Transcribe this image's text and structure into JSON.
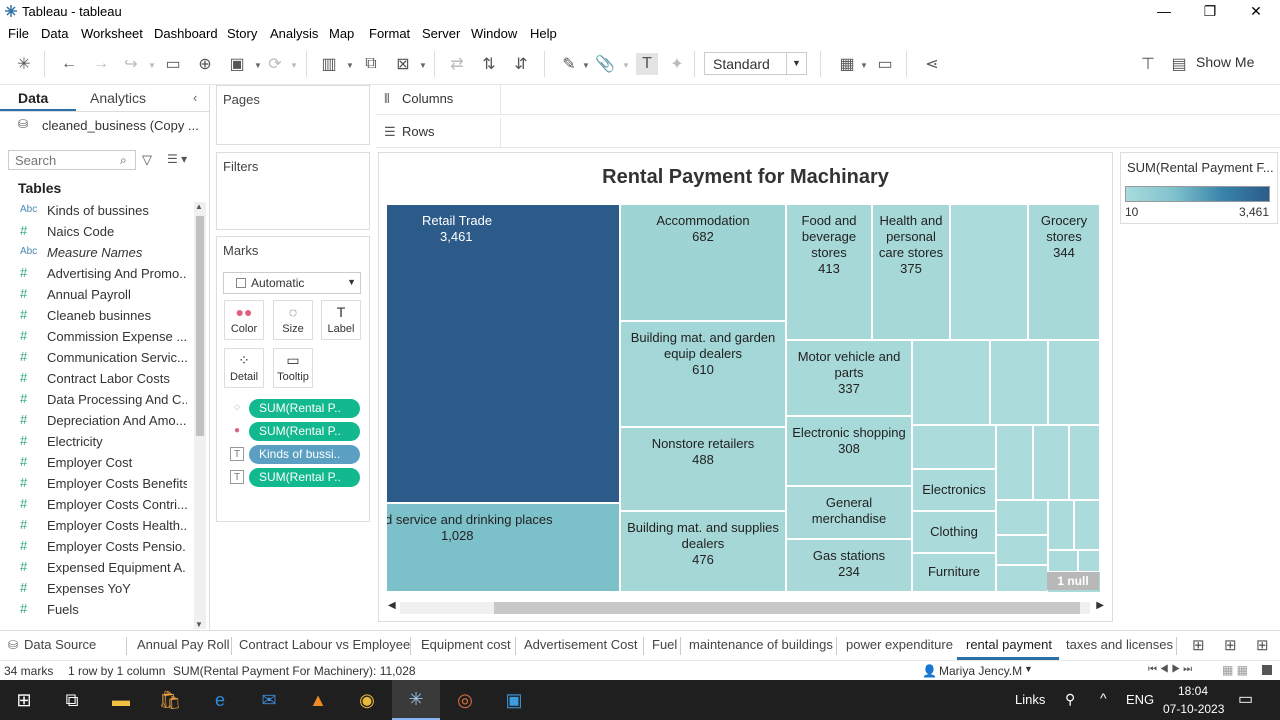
{
  "window": {
    "title": "Tableau - tableau"
  },
  "menu": [
    "File",
    "Data",
    "Worksheet",
    "Dashboard",
    "Story",
    "Analysis",
    "Map",
    "Format",
    "Server",
    "Window",
    "Help"
  ],
  "toolbar": {
    "fit": "Standard",
    "show_me": "Show Me"
  },
  "data_pane": {
    "tabs": [
      "Data",
      "Analytics"
    ],
    "datasource": "cleaned_business (Copy ...",
    "search_placeholder": "Search",
    "tables_label": "Tables",
    "fields": [
      {
        "type": "Abc",
        "name": "Kinds of bussines"
      },
      {
        "type": "#",
        "name": "Naics Code"
      },
      {
        "type": "Abc",
        "name": "Measure Names"
      },
      {
        "type": "#",
        "name": "Advertising And Promo..."
      },
      {
        "type": "#",
        "name": "Annual Payroll"
      },
      {
        "type": "#",
        "name": "Cleaneb businnes"
      },
      {
        "type": "#",
        "name": "Commission Expense ..."
      },
      {
        "type": "#",
        "name": "Communication Servic..."
      },
      {
        "type": "#",
        "name": "Contract Labor Costs"
      },
      {
        "type": "#",
        "name": "Data Processing And C..."
      },
      {
        "type": "#",
        "name": "Depreciation And Amo..."
      },
      {
        "type": "#",
        "name": "Electricity"
      },
      {
        "type": "#",
        "name": "Employer Cost"
      },
      {
        "type": "#",
        "name": "Employer Costs Benefits"
      },
      {
        "type": "#",
        "name": "Employer Costs Contri..."
      },
      {
        "type": "#",
        "name": "Employer Costs Health..."
      },
      {
        "type": "#",
        "name": "Employer Costs Pensio..."
      },
      {
        "type": "#",
        "name": "Expensed Equipment A..."
      },
      {
        "type": "#",
        "name": "Expenses YoY"
      },
      {
        "type": "#",
        "name": "Fuels"
      }
    ]
  },
  "pages_label": "Pages",
  "filters_label": "Filters",
  "marks": {
    "label": "Marks",
    "type": "Automatic",
    "buttons": [
      "Color",
      "Size",
      "Label",
      "Detail",
      "Tooltip"
    ],
    "pills": [
      "SUM(Rental P..",
      "SUM(Rental P..",
      "Kinds of bussi..",
      "SUM(Rental P.."
    ]
  },
  "shelves": {
    "columns": "Columns",
    "rows": "Rows"
  },
  "viz": {
    "title": "Rental Payment for Machinary",
    "cells": [
      {
        "label": "Retail Trade",
        "value": "3,461",
        "color": "#2c5b89",
        "dark": true
      },
      {
        "label": "d service and drinking places",
        "value": "1,028",
        "color": "#7cc0c9"
      },
      {
        "label": "Accommodation",
        "value": "682",
        "color": "#9fd4d4"
      },
      {
        "label": "Building mat. and garden equip dealers",
        "value": "610",
        "color": "#a3d6d6"
      },
      {
        "label": "Nonstore retailers",
        "value": "488",
        "color": "#a4d7d6"
      },
      {
        "label": "Building mat. and supplies dealers",
        "value": "476",
        "color": "#a5d7d6"
      },
      {
        "label": "Food and beverage stores",
        "value": "413",
        "color": "#a6d8d7"
      },
      {
        "label": "Health and personal care stores",
        "value": "375",
        "color": "#a6d8d7"
      },
      {
        "label": "Grocery stores",
        "value": "344",
        "color": "#a7d9d8"
      },
      {
        "label": "Motor vehicle and parts",
        "value": "337",
        "color": "#a7d9d8"
      },
      {
        "label": "Electronic shopping",
        "value": "308",
        "color": "#a7d9d8"
      },
      {
        "label": "General merchandise",
        "value": "",
        "color": "#a8d9d8"
      },
      {
        "label": "Gas stations",
        "value": "234",
        "color": "#a8d9d8"
      },
      {
        "label": "Electronics",
        "value": "",
        "color": "#aadad9"
      },
      {
        "label": "Clothing",
        "value": "",
        "color": "#aadad9"
      },
      {
        "label": "Furniture",
        "value": "",
        "color": "#abdbda"
      }
    ],
    "null_badge": "1 null"
  },
  "legend": {
    "title": "SUM(Rental Payment F...",
    "min": "10",
    "max": "3,461"
  },
  "sheet_tabs": [
    "Data Source",
    "Annual Pay Roll",
    "Contract Labour vs Employee",
    "Equipment cost",
    "Advertisement Cost",
    "Fuel",
    "maintenance of buildings",
    "power expenditure",
    "rental payment",
    "taxes and licenses"
  ],
  "status": {
    "marks": "34 marks",
    "dims": "1 row by 1 column",
    "sum": "SUM(Rental Payment For Machinery): 11,028",
    "user": "Mariya Jency.M"
  },
  "taskbar": {
    "links": "Links",
    "lang": "ENG",
    "time": "18:04",
    "date": "07-10-2023"
  }
}
